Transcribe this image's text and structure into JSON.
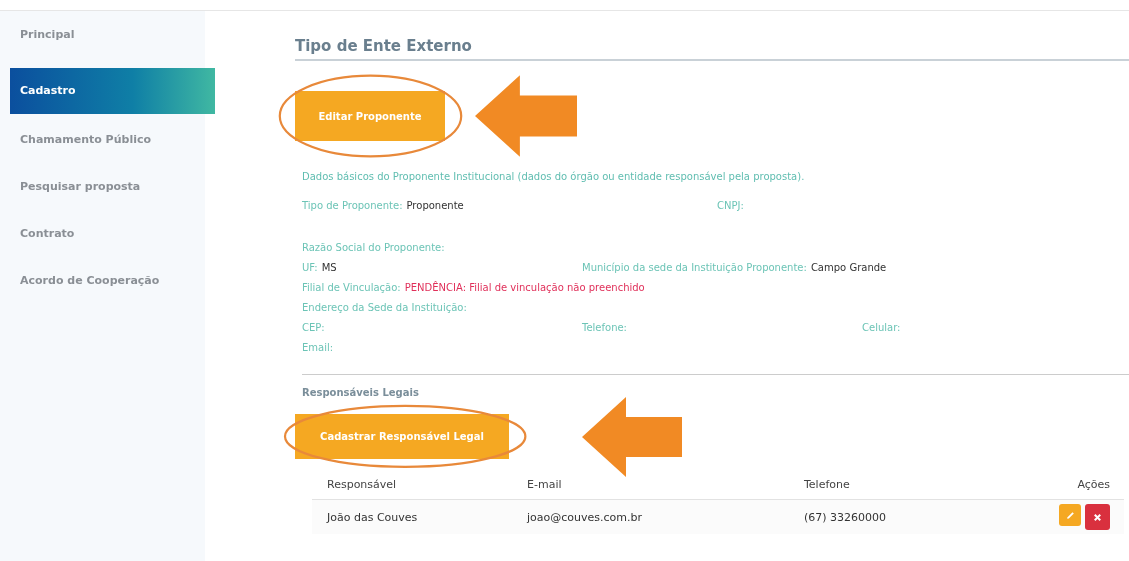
{
  "sidebar": {
    "items": [
      {
        "label": "Principal",
        "selected": false
      },
      {
        "label": "Cadastro",
        "selected": true
      },
      {
        "label": "Chamamento Público",
        "selected": false
      },
      {
        "label": "Pesquisar proposta",
        "selected": false
      },
      {
        "label": "Contrato",
        "selected": false
      },
      {
        "label": "Acordo de Cooperação",
        "selected": false
      }
    ]
  },
  "title": "Tipo de Ente Externo",
  "edit_button": {
    "label": "Editar Proponente",
    "highlighted": true
  },
  "intro": "Dados básicos do Proponente Institucional (dados do órgão ou entidade responsável pela proposta).",
  "field_rows": [
    [
      {
        "label": "Tipo de Proponente:",
        "value": "Proponente"
      },
      {
        "label": "CNPJ:"
      }
    ],
    [
      {
        "label": "Razão Social do Proponente:"
      }
    ],
    [
      {
        "label": "UF:",
        "value": "MS"
      },
      {
        "label": "Município da sede da Instituição Proponente:",
        "value": "Campo Grande"
      }
    ],
    [
      {
        "label": "Filial de Vinculação:",
        "value": "PENDÊNCIA: Filial de vinculação não preenchido",
        "kind": "warning"
      }
    ],
    [
      {
        "label": "Endereço da Sede da Instituição:"
      }
    ],
    [
      {
        "label": "CEP:"
      },
      {
        "label": "Telefone:"
      },
      {
        "label": "Celular:"
      }
    ],
    [
      {
        "label": "Email:"
      }
    ]
  ],
  "responsaveis": {
    "title": "Responsáveis Legais",
    "add_button": {
      "label": "Cadastrar Responsável Legal",
      "highlighted": true
    },
    "columns": [
      "Responsável",
      "E-mail",
      "Telefone",
      "Ações"
    ],
    "rows": [
      [
        "João das Couves",
        "joao@couves.com.br",
        "(67) 33260000"
      ]
    ]
  }
}
